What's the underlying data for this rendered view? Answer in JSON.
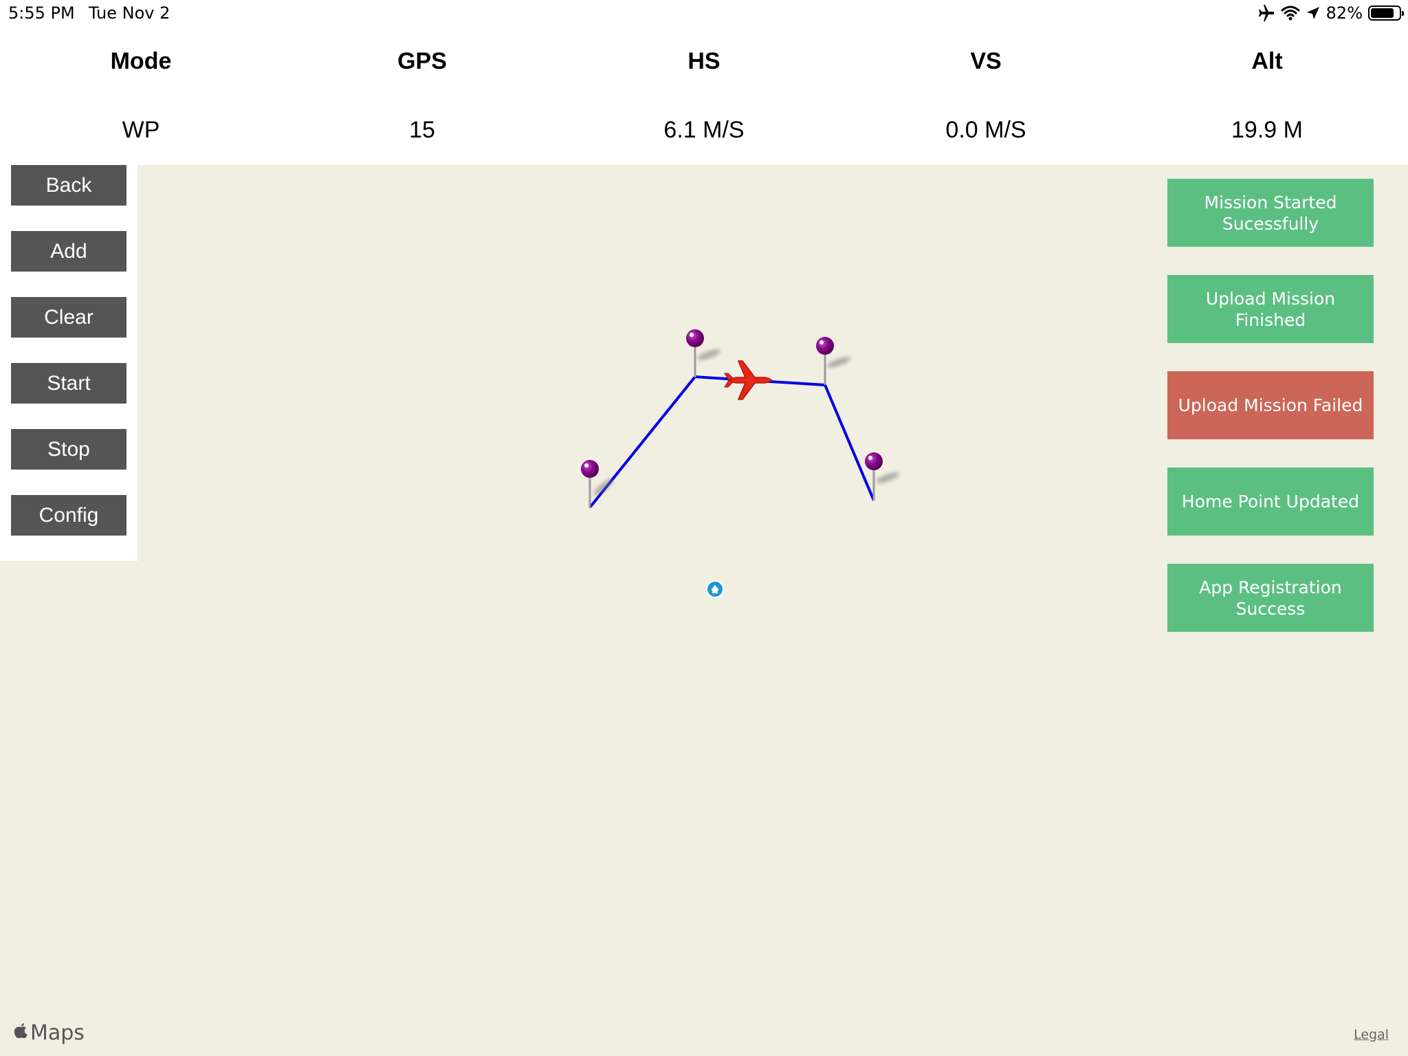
{
  "status_bar": {
    "time": "5:55 PM",
    "date": "Tue Nov 2",
    "battery_percent": "82%",
    "battery_level": 0.82,
    "icons": [
      "airplane-mode-icon",
      "wifi-icon",
      "location-arrow-icon",
      "battery-icon"
    ]
  },
  "telemetry": {
    "columns": [
      {
        "label": "Mode",
        "value": "WP"
      },
      {
        "label": "GPS",
        "value": "15"
      },
      {
        "label": "HS",
        "value": "6.1 M/S"
      },
      {
        "label": "VS",
        "value": "0.0 M/S"
      },
      {
        "label": "Alt",
        "value": "19.9 M"
      }
    ]
  },
  "controls": {
    "buttons": [
      {
        "label": "Back"
      },
      {
        "label": "Add"
      },
      {
        "label": "Clear"
      },
      {
        "label": "Start"
      },
      {
        "label": "Stop"
      },
      {
        "label": "Config"
      }
    ]
  },
  "notices": [
    {
      "text": "Mission Started Sucessfully",
      "status": "success"
    },
    {
      "text": "Upload Mission Finished",
      "status": "success"
    },
    {
      "text": "Upload Mission Failed",
      "status": "failure"
    },
    {
      "text": "Home Point Updated",
      "status": "success"
    },
    {
      "text": "App Registration Success",
      "status": "success"
    }
  ],
  "map": {
    "provider_label": "Maps",
    "legal_label": "Legal",
    "route_color": "#0000e6",
    "pin_color": "#8a0a8f",
    "aircraft_color": "#e8261a",
    "home_color": "#1e96d6",
    "waypoint_count": 4
  },
  "colors": {
    "button_bg": "#555555",
    "success": "#5cbf82",
    "failure": "#cc6658",
    "map_bg": "#f1eee2"
  }
}
